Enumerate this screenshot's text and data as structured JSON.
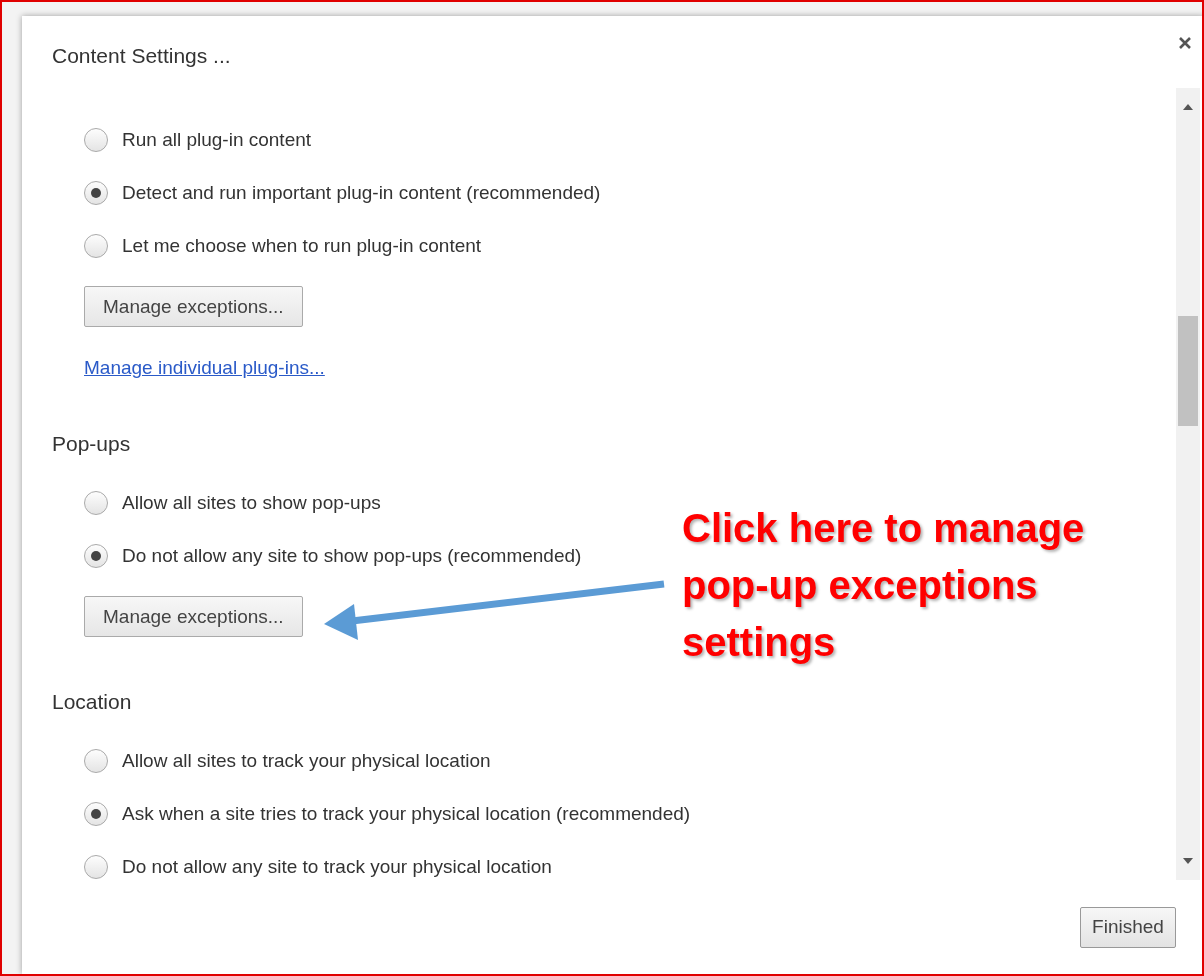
{
  "dialog": {
    "title": "Content Settings ...",
    "sections": [
      {
        "options": [
          {
            "label": "Run all plug-in content",
            "selected": false
          },
          {
            "label": "Detect and run important plug-in content (recommended)",
            "selected": true
          },
          {
            "label": "Let me choose when to run plug-in content",
            "selected": false
          }
        ],
        "buttons": [
          "Manage exceptions..."
        ],
        "link": "Manage individual plug-ins..."
      },
      {
        "heading": "Pop-ups",
        "options": [
          {
            "label": "Allow all sites to show pop-ups",
            "selected": false
          },
          {
            "label": "Do not allow any site to show pop-ups (recommended)",
            "selected": true
          }
        ],
        "buttons": [
          "Manage exceptions..."
        ]
      },
      {
        "heading": "Location",
        "options": [
          {
            "label": "Allow all sites to track your physical location",
            "selected": false
          },
          {
            "label": "Ask when a site tries to track your physical location (recommended)",
            "selected": true
          },
          {
            "label": "Do not allow any site to track your physical location",
            "selected": false
          }
        ]
      }
    ],
    "footer_button": "Finished"
  },
  "annotation": {
    "text": "Click here to manage pop-up exceptions settings"
  }
}
